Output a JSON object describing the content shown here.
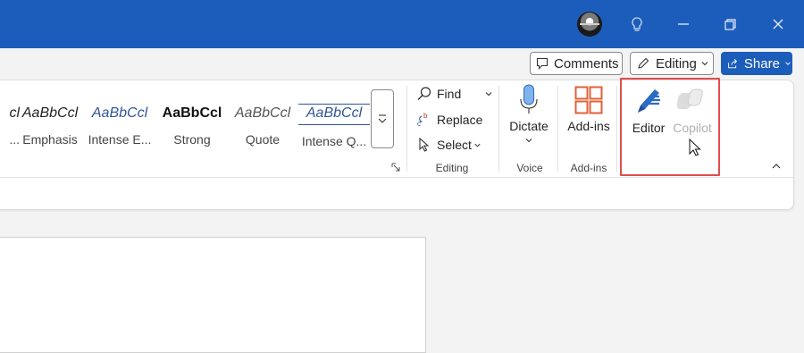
{
  "titlebar": {
    "bg": "#1c5dbb"
  },
  "topbar": {
    "comments_label": "Comments",
    "editing_label": "Editing",
    "share_label": "Share"
  },
  "styles": [
    {
      "sample": "cl",
      "name": "..."
    },
    {
      "sample": "AaBbCcl",
      "name": "Emphasis"
    },
    {
      "sample": "AaBbCcl",
      "name": "Intense E..."
    },
    {
      "sample": "AaBbCcl",
      "name": "Strong"
    },
    {
      "sample": "AaBbCcl",
      "name": "Quote"
    },
    {
      "sample": "AaBbCcl",
      "name": "Intense Q..."
    }
  ],
  "editing": {
    "find_label": "Find",
    "replace_label": "Replace",
    "select_label": "Select",
    "group_label": "Editing"
  },
  "voice": {
    "dictate_label": "Dictate",
    "group_label": "Voice"
  },
  "addins": {
    "label": "Add-ins",
    "group_label": "Add-ins"
  },
  "editor": {
    "label": "Editor"
  },
  "copilot": {
    "label": "Copilot"
  },
  "icons": {
    "avatar": "user-avatar",
    "lightbulb": "lightbulb-icon",
    "minimize": "minimize-icon",
    "restore": "restore-icon",
    "close": "close-icon",
    "find": "magnifier-icon",
    "replace": "replace-icon",
    "select": "cursor-select-icon",
    "dictate": "microphone-icon",
    "addins": "grid-icon",
    "editor": "pen-icon",
    "copilot": "copilot-icon"
  },
  "colors": {
    "accent": "#1c5dbb",
    "highlight": "#e04d4d",
    "style_blue": "#2f5597"
  }
}
